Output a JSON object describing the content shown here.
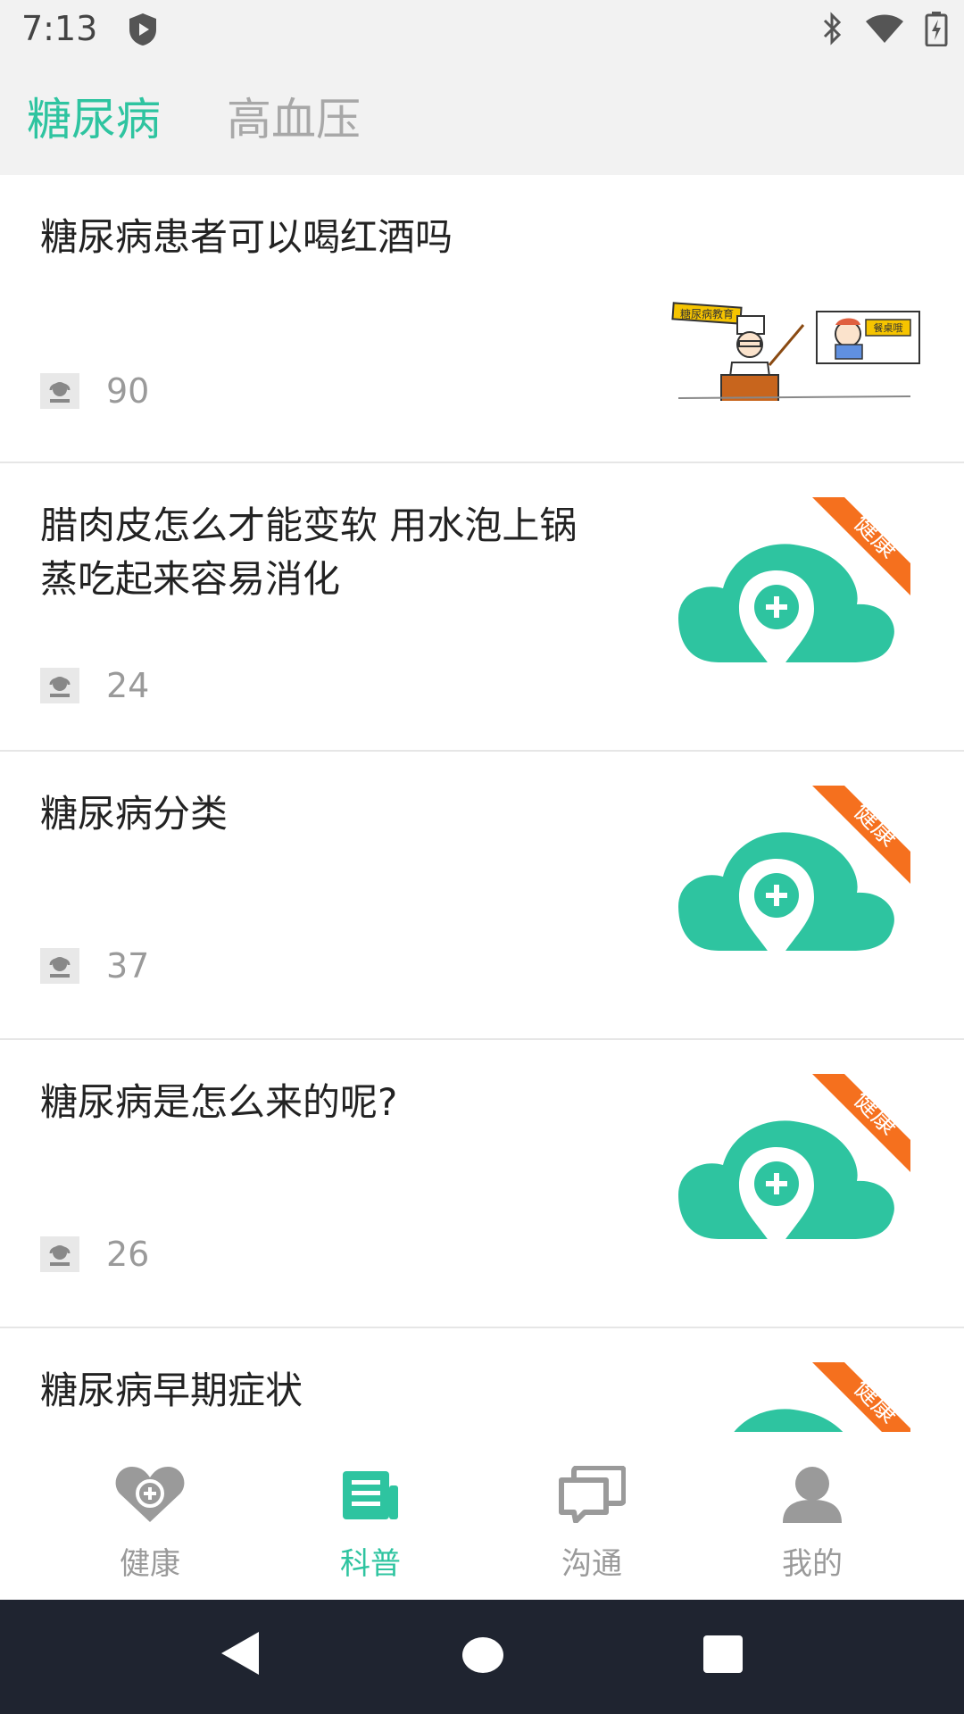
{
  "status_bar": {
    "time": "7:13",
    "icons": [
      "shield-icon",
      "bluetooth-icon",
      "wifi-icon",
      "battery-charging-icon"
    ]
  },
  "tabs": [
    {
      "label": "糖尿病",
      "active": true
    },
    {
      "label": "高血压",
      "active": false
    }
  ],
  "articles": [
    {
      "title": "糖尿病患者可以喝红酒吗",
      "views": "90",
      "thumbnail": "cartoon-illustration"
    },
    {
      "title": "腊肉皮怎么才能变软 用水泡上锅蒸吃起来容易消化",
      "views": "24",
      "thumbnail": "health-cloud-logo"
    },
    {
      "title": "糖尿病分类",
      "views": "37",
      "thumbnail": "health-cloud-logo"
    },
    {
      "title": "糖尿病是怎么来的呢?",
      "views": "26",
      "thumbnail": "health-cloud-logo"
    },
    {
      "title": "糖尿病早期症状",
      "views": "",
      "thumbnail": "health-cloud-logo"
    }
  ],
  "thumb_ribbon_text": "健康",
  "cartoon_signs": {
    "left": "糖尿病教育",
    "right": "餐桌哦"
  },
  "bottom_nav": [
    {
      "label": "健康",
      "icon": "heart-plus-icon",
      "active": false
    },
    {
      "label": "科普",
      "icon": "newspaper-icon",
      "active": true
    },
    {
      "label": "沟通",
      "icon": "chat-icon",
      "active": false
    },
    {
      "label": "我的",
      "icon": "person-icon",
      "active": false
    }
  ],
  "colors": {
    "accent": "#2ec4a0",
    "ribbon": "#f5701e",
    "inactive": "#9a9a9a",
    "nav_bar": "#1f2430"
  }
}
